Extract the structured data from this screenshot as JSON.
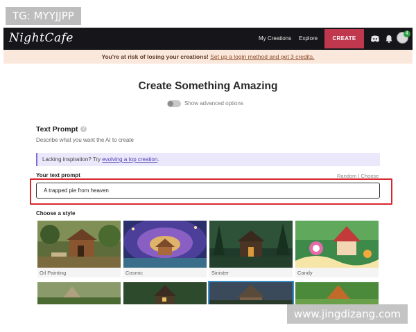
{
  "watermarks": {
    "top": "TG: MYYJJPP",
    "bottom": "www.jingdizang.com"
  },
  "navbar": {
    "logo": "NightCafe",
    "links": [
      "My Creations",
      "Explore"
    ],
    "create_label": "CREATE",
    "icons": [
      "discord-icon",
      "bell-icon",
      "avatar"
    ],
    "badge_count": "4",
    "colors": {
      "bar": "#16161a",
      "create": "#c0384e"
    }
  },
  "alert": {
    "text": "You're at risk of losing your creations!",
    "link": "Set up a login method and get 3 credits."
  },
  "page": {
    "title": "Create Something Amazing",
    "advanced_toggle": "Show advanced options"
  },
  "prompt_section": {
    "title": "Text Prompt",
    "help_icon": "?",
    "description": "Describe what you want the AI to create",
    "inspiration_prefix": "Lacking inspiration? Try",
    "inspiration_link": "evolving a top creation",
    "inspiration_suffix": ".",
    "input_label": "Your text prompt",
    "random_choose": "Random | Choose",
    "input_value": "A trapped pie from heaven"
  },
  "styles": {
    "label": "Choose a style",
    "items": [
      {
        "name": "Oil Painting"
      },
      {
        "name": "Cosmic"
      },
      {
        "name": "Sinister"
      },
      {
        "name": "Candy"
      }
    ]
  }
}
